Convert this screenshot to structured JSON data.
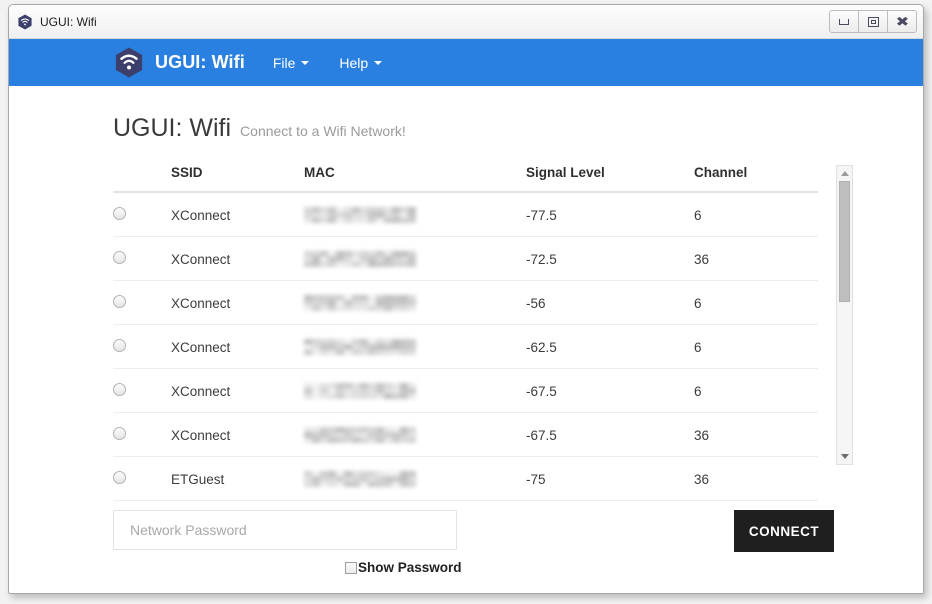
{
  "window": {
    "title": "UGUI: Wifi",
    "icon": "wifi-hexagon-icon",
    "controls": {
      "minimize": "minimize-icon",
      "maximize": "maximize-icon",
      "close": "close-icon"
    }
  },
  "navbar": {
    "logo": "wifi-hexagon-icon",
    "brand": "UGUI: Wifi",
    "background_color": "#2a80e1",
    "items": [
      {
        "label": "File",
        "has_caret": true
      },
      {
        "label": "Help",
        "has_caret": true
      }
    ]
  },
  "page": {
    "title": "UGUI: Wifi",
    "subtitle": "Connect to a Wifi Network!"
  },
  "table": {
    "columns": [
      "",
      "SSID",
      "MAC",
      "Signal Level",
      "Channel"
    ],
    "rows": [
      {
        "selected": false,
        "ssid": "XConnect",
        "mac": "",
        "mac_redacted": true,
        "signal": "-77.5",
        "channel": "6"
      },
      {
        "selected": false,
        "ssid": "XConnect",
        "mac": "",
        "mac_redacted": true,
        "signal": "-72.5",
        "channel": "36"
      },
      {
        "selected": false,
        "ssid": "XConnect",
        "mac": "",
        "mac_redacted": true,
        "signal": "-56",
        "channel": "6"
      },
      {
        "selected": false,
        "ssid": "XConnect",
        "mac": "",
        "mac_redacted": true,
        "signal": "-62.5",
        "channel": "6"
      },
      {
        "selected": false,
        "ssid": "XConnect",
        "mac": "",
        "mac_redacted": true,
        "signal": "-67.5",
        "channel": "6"
      },
      {
        "selected": false,
        "ssid": "XConnect",
        "mac": "",
        "mac_redacted": true,
        "signal": "-67.5",
        "channel": "36"
      },
      {
        "selected": false,
        "ssid": "ETGuest",
        "mac": "",
        "mac_redacted": true,
        "signal": "-75",
        "channel": "36"
      }
    ]
  },
  "scrollbar": {
    "up_icon": "chevron-up-icon",
    "down_icon": "chevron-down-icon",
    "thumb_position_pct": 0,
    "thumb_size_pct": 45
  },
  "form": {
    "password_placeholder": "Network Password",
    "password_value": "",
    "show_password_label": "Show Password",
    "show_password_checked": false,
    "connect_label": "CONNECT",
    "connect_color": "#1f1f1f"
  }
}
